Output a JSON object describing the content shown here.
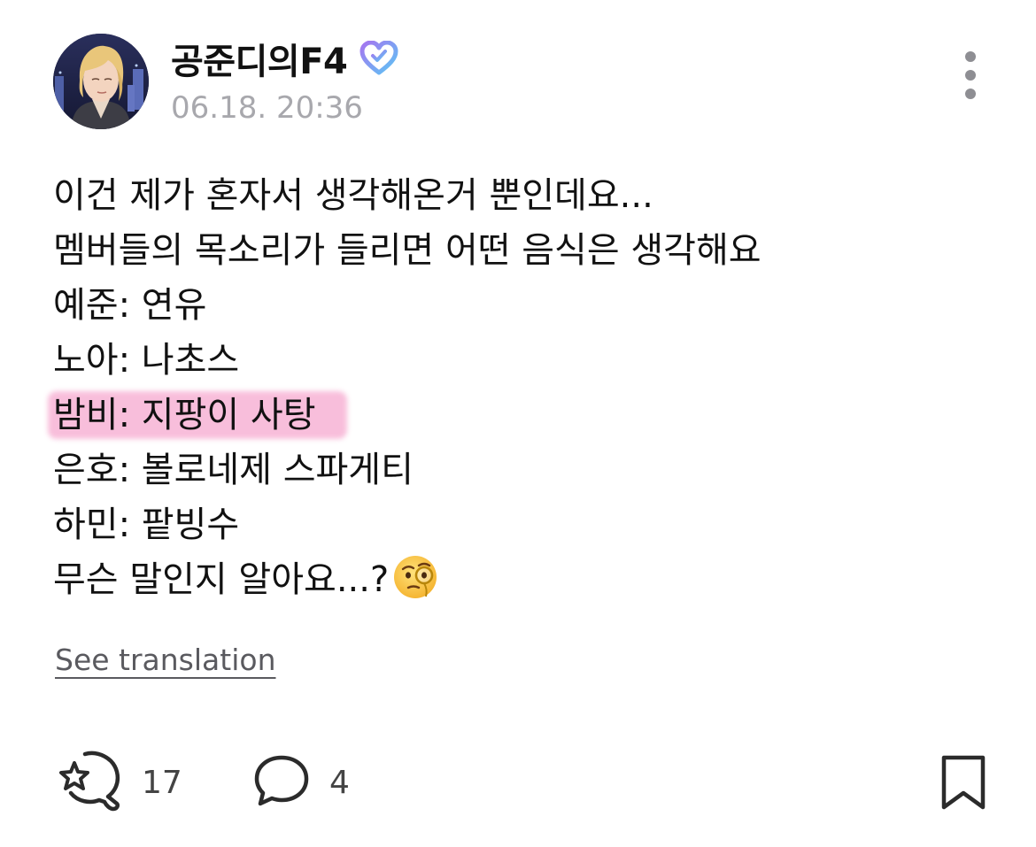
{
  "post": {
    "author": "공준디의F4",
    "timestamp": "06.18. 20:36",
    "lines": [
      "이건 제가 혼자서 생각해온거 뿐인데요...",
      "멤버들의 목소리가 들리면 어떤 음식은 생각해요",
      "예준: 연유",
      "노아: 나초스",
      "밤비: 지팡이 사탕",
      "은호: 볼로네제 스파게티",
      "하민: 팥빙수",
      "무슨 말인지 알아요...?"
    ],
    "highlighted_line_index": 4,
    "trailing_emoji": "face-with-monocle-emoji",
    "see_translation": "See translation"
  },
  "actions": {
    "like_count": "17",
    "comment_count": "4"
  },
  "colors": {
    "highlight": "#f6a9cf",
    "badge_gradient_start": "#a575f0",
    "badge_gradient_end": "#5cc6f4",
    "timestamp": "#a8a8ad"
  },
  "icons": {
    "badge": "verified-heart-icon",
    "more": "more-options-icon",
    "like": "like-reaction-icon",
    "comment": "comment-icon",
    "bookmark": "bookmark-icon"
  }
}
